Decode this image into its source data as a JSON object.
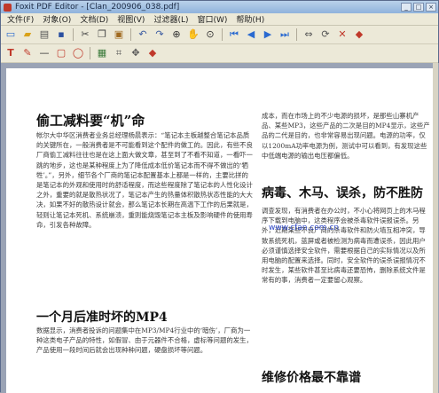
{
  "window": {
    "title": "Foxit PDF Editor - [Clan_20090​6_038.pdf]"
  },
  "menu": [
    "文件(F)",
    "对象(O)",
    "文档(D)",
    "视图(V)",
    "过滤器(L)",
    "窗口(W)",
    "帮助(H)"
  ],
  "toolbar1_icons": [
    "new-icon",
    "open-icon",
    "print-icon",
    "save-icon",
    "cut-icon",
    "copy-icon",
    "paste-icon",
    "undo-icon",
    "redo-icon",
    "zoom-icon",
    "hand-icon",
    "select-icon",
    "first-page-icon",
    "prev-page-icon",
    "next-page-icon",
    "last-page-icon",
    "fit-icon",
    "rotate-icon",
    "delete-icon",
    "properties-icon"
  ],
  "toolbar2_icons": [
    "text-tool-icon",
    "pen-icon",
    "line-icon",
    "rectangle-icon",
    "ellipse-icon",
    "image-icon",
    "crop-icon",
    "move-icon",
    "color-icon"
  ],
  "watermark": "www.cfan.com.cn",
  "left": {
    "h1": "偷工减料要“机”命",
    "p1": "    帐尔大中华区消费者业务总经理杨晨表示：“笔记本主板越整合笔记本品质的关键所在，一般消费者是不可能看到这个配件的做工的。因此，有些不良厂商偷工减料往往也是在这上面大做文章，甚至到了不看不知道，一看吓一跳的地步，这也是某种程度上为了降低成本低价笔记本而不得不做出的‘牺牲’。”，另外，细节各个厂商的笔记本配置基本上都是一样的，主要比拼的是笔记本的外观和使用时的舒适程度，而这些程度除了笔记本的人性化设计之外，重要的就是散热状况了，笔记本产生的热量体积散热状态性能的大大决，如果不好的散热设计就会，那么笔记本长期在高温下工作的后果就是，轻则让笔记本死机、系统崩溃，重则能烧毁笔记本主板及影响硬件的使用寿命，引发各种故障。",
    "h2": "一个月后准时坏的MP4",
    "p2": "    数据显示，消费者投诉的问题集中在MP3/MP4行业中的‘暗伤’，厂商为一种这类电子产品的特性，如假冒、由于元器件不合格，虚标等问题的发生，产品使用一段时间后就会出现种种问题，硬盘损坏等问题。"
  },
  "right": {
    "p0": "成本，而在市场上的不少电源的损坏，是那些山寨机产品、某些MP3，这些产品的二次是目的MP4显示，这些产品的二代是目的，也非常容易出现问题。电源的功率，仅以1200mA功率电源为例，测试中可以看到，有发现这些中低端电源的输出电压都偏低。",
    "h1": "病毒、木马、误杀，防不胜防",
    "p1": "    调查发现，有消费者在办公时，不小心将网页上的木马程序下载到电脑中，这类程序会被杀毒软件误报误杀。另外，近期某些不良厂商的杀毒软件和防火墙互相冲突，导致系统死机，蓝屏或者被检测为病毒而遭误杀，因此用户必须谨慎选择安全软件，需要根据自己的实际情况以及所用电脑的配置来选择。同时，安全软件的误杀误报情况不时发生，某些软件甚至比病毒还要恐怖，删除系统文件是常有的事，消费者一定要留心观察。",
    "h2": "维修价格最不靠谱"
  }
}
